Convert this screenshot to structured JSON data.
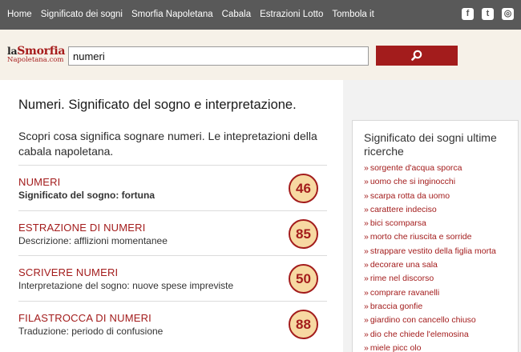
{
  "nav": {
    "links": [
      "Home",
      "Significato dei sogni",
      "Smorfia Napoletana",
      "Cabala",
      "Estrazioni Lotto",
      "Tombola it"
    ],
    "social": [
      {
        "icon": "facebook-icon",
        "glyph": "f"
      },
      {
        "icon": "twitter-icon",
        "glyph": "t"
      },
      {
        "icon": "instagram-icon",
        "glyph": "◎"
      }
    ]
  },
  "logo": {
    "line1_a": "la",
    "line1_b": "Smorfia",
    "line2": "Napoletana.com"
  },
  "search": {
    "value": "numeri",
    "button_icon": "search-icon"
  },
  "main": {
    "title": "Numeri. Significato del sogno e interpretazione.",
    "intro": "Scopri cosa significa sognare numeri. Le intepretazioni della cabala napoletana.",
    "results": [
      {
        "title": "Numeri",
        "desc": "Significato del sogno: fortuna",
        "number": "46",
        "bold": true
      },
      {
        "title": "Estrazione di numeri",
        "desc": "Descrizione: afflizioni momentanee",
        "number": "85",
        "bold": false
      },
      {
        "title": "Scrivere numeri",
        "desc": "Interpretazione del sogno: nuove spese impreviste",
        "number": "50",
        "bold": false
      },
      {
        "title": "Filastrocca di numeri",
        "desc": "Traduzione: periodo di confusione",
        "number": "88",
        "bold": false
      }
    ]
  },
  "sidebar": {
    "title": "Significato dei sogni ultime ricerche",
    "prefix": "»",
    "items": [
      "sorgente d'acqua sporca",
      "uomo che si inginocchi",
      "scarpa rotta da uomo",
      "carattere indeciso",
      "bici scomparsa",
      "morto che riuscita e sorride",
      "strappare vestito della figlia morta",
      "decorare una sala",
      "rime nel discorso",
      "comprare ravanelli",
      "braccia gonfie",
      "giardino con cancello chiuso",
      "dio che chiede l'elemosina",
      "miele picc olo"
    ]
  },
  "colors": {
    "accent": "#a31c1c",
    "nav_bg": "#595959",
    "band_bg": "#f6f1e8",
    "badge_bg": "#f7d9a2"
  }
}
